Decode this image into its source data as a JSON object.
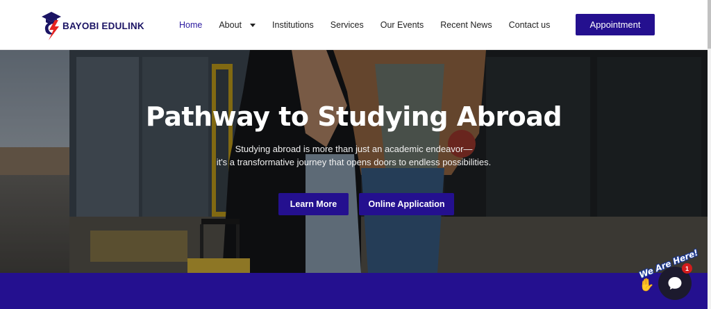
{
  "brand": {
    "name": "BAYOBI EDULINK"
  },
  "nav": {
    "items": [
      {
        "label": "Home",
        "active": true
      },
      {
        "label": "About",
        "dropdown": true
      },
      {
        "label": "Institutions"
      },
      {
        "label": "Services"
      },
      {
        "label": "Our Events"
      },
      {
        "label": "Recent News"
      },
      {
        "label": "Contact us"
      }
    ],
    "cta_label": "Appointment"
  },
  "hero": {
    "title": "Pathway to Studying Abroad",
    "subtitle_line1": "Studying abroad is more than just an academic endeavor—",
    "subtitle_line2": "it's a transformative journey that opens doors to endless possibilities.",
    "primary_button": "Learn More",
    "secondary_button": "Online Application"
  },
  "chat": {
    "tagline": "We Are Here!",
    "badge_count": "1"
  },
  "colors": {
    "brand_primary": "#24108f",
    "nav_active": "#2b1aa0",
    "badge": "#d21c1c"
  }
}
